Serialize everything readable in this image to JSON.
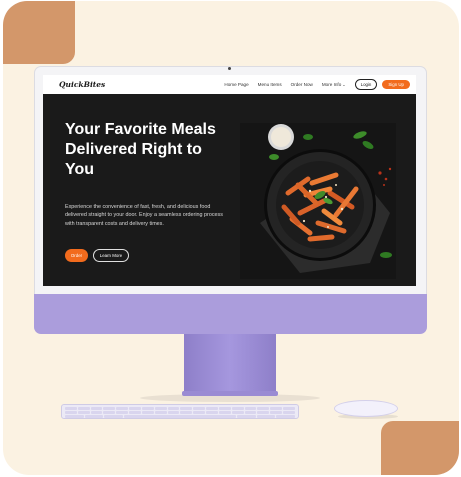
{
  "site": {
    "logo": "QuickBites",
    "nav": {
      "links": [
        "Home Page",
        "Menu Items",
        "Order Now",
        "More Info"
      ],
      "login_label": "Login",
      "signup_label": "Sign Up"
    },
    "hero": {
      "title": "Your Favorite Meals Delivered Right to You",
      "description": "Experience the convenience of fast, fresh, and delicious food delivered straight to your door. Enjoy a seamless ordering process with transparent costs and delivery times.",
      "order_label": "Order",
      "learn_label": "Learn More",
      "image_icon": "pasta-dish-image"
    }
  },
  "colors": {
    "accent": "#f26b1d",
    "screen_bg": "#1a1a1a",
    "card_bg": "#fbf2e2",
    "deco": "#d3976a",
    "imac_purple": "#ab9ddc"
  }
}
